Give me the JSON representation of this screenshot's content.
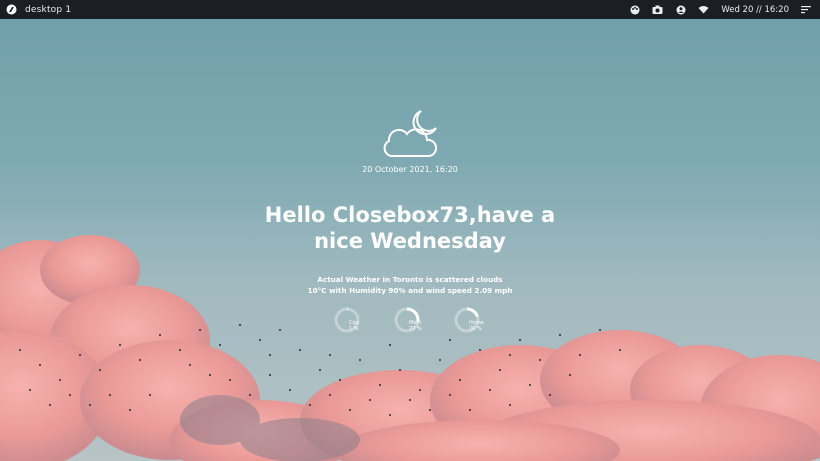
{
  "topbar": {
    "workspace_label": "desktop 1",
    "clock": "Wed 20 // 16:20",
    "icons": [
      "logo-icon",
      "palette-icon",
      "camera-icon",
      "user-icon",
      "wifi-icon",
      "menu-icon"
    ]
  },
  "main": {
    "weather_icon": "cloud-moon-icon",
    "date": "20 October 2021, 16:20",
    "greeting_line1": "Hello Closebox73,have a",
    "greeting_line2": "nice Wednesday",
    "status_line1": "Actual Weather in Toronto is scattered clouds",
    "status_line2": "10°C with Humidity 90% and wind speed 2.09 mph"
  },
  "gauges": [
    {
      "name": "Cpu",
      "value": "1 %",
      "fraction": 0.01
    },
    {
      "name": "Mem",
      "value": "27 %",
      "fraction": 0.27
    },
    {
      "name": "Home",
      "value": "20 %",
      "fraction": 0.2
    }
  ],
  "colors": {
    "topbar_bg": "#1b1f24",
    "sky_top": "#6f9ea8",
    "cloud_pink": "#f2a0a0",
    "text": "#ffffff"
  }
}
